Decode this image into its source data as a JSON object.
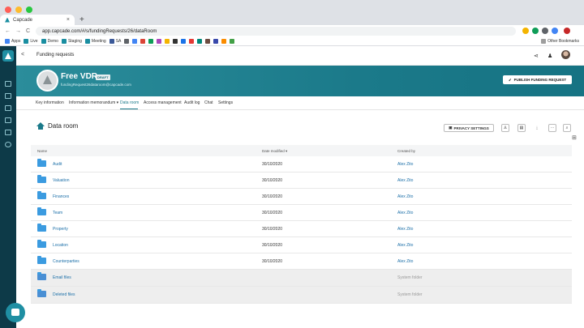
{
  "browser": {
    "tab_title": "Capcade",
    "tab_close": "×",
    "new_tab": "+",
    "url": "app.capcade.com/#/s/fundingRequests/26/dataRoom",
    "nav": {
      "back": "←",
      "forward": "→",
      "reload": "C"
    },
    "traffic": [
      "#ff5f57",
      "#febc2e",
      "#28c840"
    ],
    "bookmarks": [
      {
        "label": "Apps",
        "color": "#4285f4"
      },
      {
        "label": "Live",
        "color": "#1a8ea1"
      },
      {
        "label": "Demo",
        "color": "#1a8ea1"
      },
      {
        "label": "Staging",
        "color": "#1a8ea1"
      },
      {
        "label": "Meeting",
        "color": "#1a8ea1"
      },
      {
        "label": "SA",
        "color": "#3b5998"
      }
    ],
    "bookmark_other": "Other Bookmarks",
    "extension_colors": [
      "#f4b400",
      "#0f9d58",
      "#db4437",
      "#4285f4",
      "#5f6368",
      "#ab47bc"
    ]
  },
  "app": {
    "back_label": "<",
    "page_title": "Funding requests",
    "vdr": {
      "title": "Free VDR",
      "badge": "DRAFT",
      "email": "fundingRequest26dataroom@capcade.com",
      "publish_label": "PUBLISH FUNDING REQUEST"
    },
    "tabs": [
      {
        "label": "Key information"
      },
      {
        "label": "Information memorandum ▾"
      },
      {
        "label": "Data room"
      },
      {
        "label": "Access management"
      },
      {
        "label": "Audit log"
      },
      {
        "label": "Chat"
      },
      {
        "label": "Settings"
      }
    ],
    "data_room": {
      "title": "Data room",
      "privacy_label": "PRIVACY SETTINGS",
      "columns": {
        "name": "Name",
        "date": "Date modified ▾",
        "by": "Created by"
      },
      "rows": [
        {
          "name": "Audit",
          "date": "30/10/2020",
          "by": "Alex Zito"
        },
        {
          "name": "Valuation",
          "date": "30/10/2020",
          "by": "Alex Zito"
        },
        {
          "name": "Finances",
          "date": "30/10/2020",
          "by": "Alex Zito"
        },
        {
          "name": "Team",
          "date": "30/10/2020",
          "by": "Alex Zito"
        },
        {
          "name": "Property",
          "date": "30/10/2020",
          "by": "Alex Zito"
        },
        {
          "name": "Location",
          "date": "30/10/2020",
          "by": "Alex Zito"
        },
        {
          "name": "Counterparties",
          "date": "30/10/2020",
          "by": "Alex Zito"
        }
      ],
      "system_rows": [
        {
          "name": "Email files",
          "by": "System folder"
        },
        {
          "name": "Deleted files",
          "by": "System folder"
        }
      ]
    },
    "colors": {
      "brand": "#1b7a8a",
      "sidebar": "#0d3a48",
      "link": "#1b6fa8"
    }
  }
}
